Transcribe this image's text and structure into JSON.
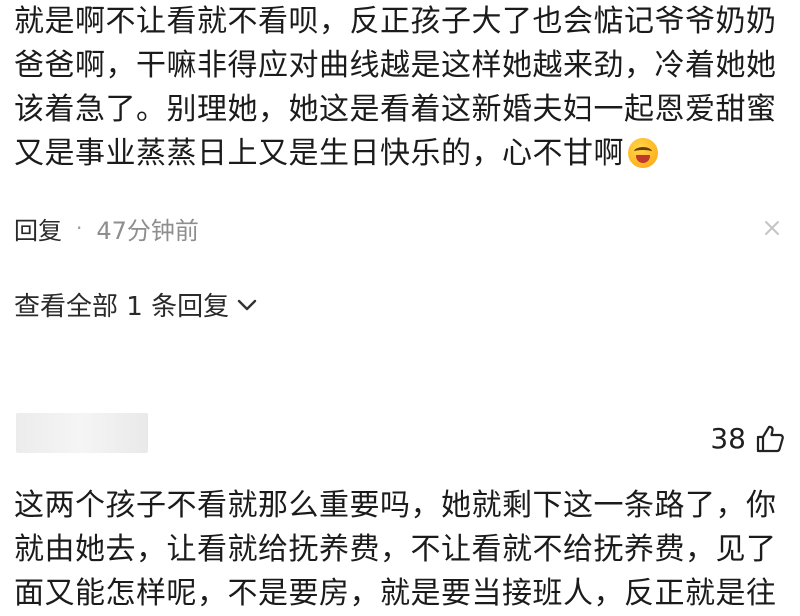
{
  "comment1": {
    "text": "就是啊不让看就不看呗，反正孩子大了也会惦记爷爷奶奶爸爸啊，干嘛非得应对曲线越是这样她越来劲，冷着她她该着急了。别理她，她这是看着这新婚夫妇一起恩爱甜蜜又是事业蒸蒸日上又是生日快乐的，心不甘啊",
    "emoji": "laughing-emoji",
    "reply_label": "回复",
    "separator": "·",
    "time": "47分钟前",
    "view_replies": "查看全部 1 条回复"
  },
  "comment2": {
    "likes": "38",
    "text": "这两个孩子不看就那么重要吗，她就剩下这一条路了，你就由她去，让看就给抚养费，不让看就不给抚养费，见了面又能怎样呢，不是要房，就是要当接班人，反正就是往"
  },
  "icons": {
    "close": "close-icon",
    "chevron": "chevron-down-icon",
    "like": "thumb-up-icon"
  }
}
